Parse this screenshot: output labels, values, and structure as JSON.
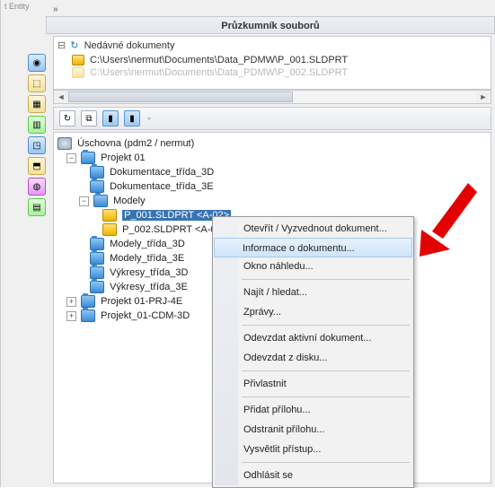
{
  "truncated_top": "t Entity",
  "panel_title": "Průzkumník souborů",
  "recent": {
    "header": "Nedávné dokumenty",
    "items": [
      "C:\\Users\\nermut\\Documents\\Data_PDMW\\P_001.SLDPRT",
      "C:\\Users\\nermut\\Documents\\Data_PDMW\\P_002.SLDPRT"
    ]
  },
  "vault_root": "Úschovna (pdm2 / nermut)",
  "tree": {
    "projekt01": "Projekt 01",
    "dok3d": "Dokumentace_třída_3D",
    "dok3e": "Dokumentace_třída_3E",
    "modely": "Modely",
    "p001": "P_001.SLDPRT <A-02>",
    "p002": "P_002.SLDPRT <A-01>",
    "mod3d": "Modely_třída_3D",
    "mod3e": "Modely_třída_3E",
    "vyk3d": "Výkresy_třída_3D",
    "vyk3e": "Výkresy_třída_3E",
    "prj4e": "Projekt 01-PRJ-4E",
    "cdm3d": "Projekt_01-CDM-3D"
  },
  "menu": {
    "open": "Otevřít / Vyzvednout dokument...",
    "info": "Informace o dokumentu...",
    "preview": "Okno náhledu...",
    "find": "Najít / hledat...",
    "reports": "Zprávy...",
    "checkin_active": "Odevzdat aktivní dokument...",
    "checkin_disk": "Odevzdat z disku...",
    "own": "Přivlastnit",
    "add_attach": "Přidat přílohu...",
    "remove_attach": "Odstranit přílohu...",
    "explain": "Vysvětlit přístup...",
    "logout": "Odhlásit se"
  }
}
